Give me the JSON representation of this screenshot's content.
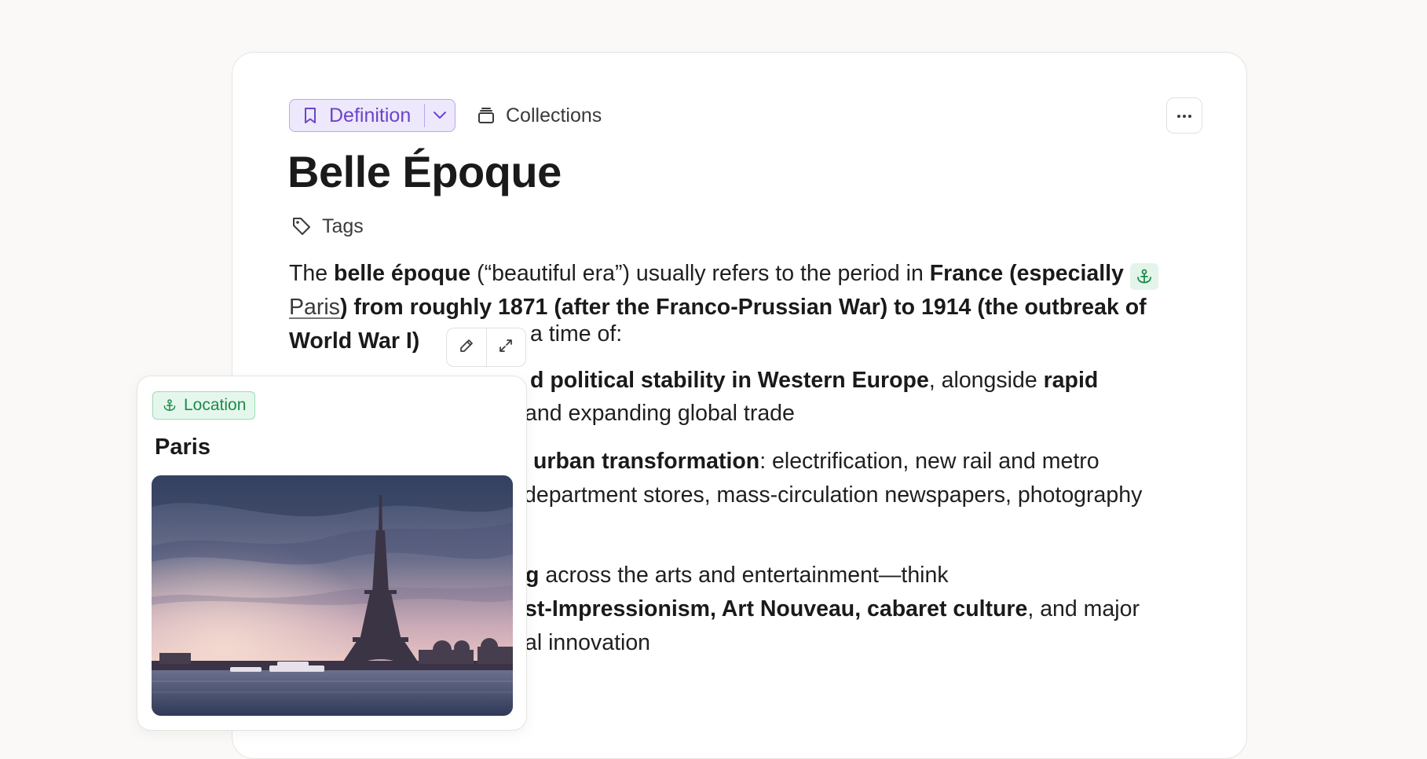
{
  "header": {
    "type_label": "Definition",
    "collections_label": "Collections",
    "more_label": "···"
  },
  "title": "Belle Époque",
  "tags_label": "Tags",
  "intro": {
    "p1": "The ",
    "b1": "belle époque",
    "p2": " (“beautiful era”) usually refers to the period in ",
    "b2": "France (especially",
    "link": "Paris",
    "b3": ") from roughly 1871 (after the Franco-Prussian War) to 1914 (the outbreak of World War I)"
  },
  "lines": {
    "time_of": "a time of:",
    "l1_b": "d political stability in Western Europe",
    "l1_t": ", alongside ",
    "l1_b2": "rapid",
    "l2": "and expanding global trade",
    "l3_b": "urban transformation",
    "l3_t": ": electrification, new rail and metro",
    "l4": "department stores, mass-circulation newspapers, photography",
    "l5_b": "g",
    "l5_t": " across the arts and entertainment—think",
    "l6_b": "st-Impressionism, Art Nouveau, cabaret culture",
    "l6_t": ", and major",
    "l7": "al innovation"
  },
  "popover": {
    "badge": "Location",
    "title": "Paris",
    "image_subject": "Eiffel Tower and Seine river at dusk"
  },
  "colors": {
    "accent_purple": "#6c44c9",
    "location_green": "#1e8a4a"
  },
  "icons": [
    "bookmark-icon",
    "chevron-down-icon",
    "collections-icon",
    "more-icon",
    "tag-icon",
    "anchor-icon",
    "pencil-icon",
    "expand-icon"
  ]
}
